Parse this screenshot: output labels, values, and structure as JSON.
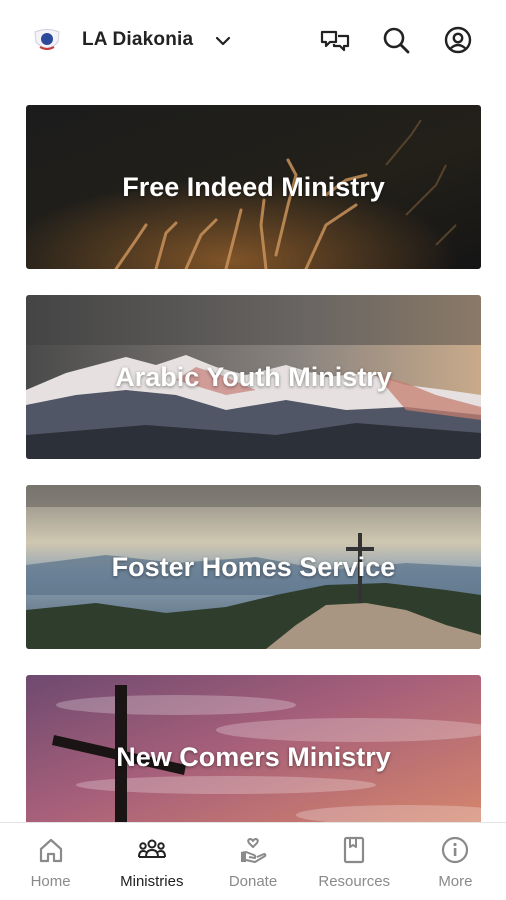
{
  "header": {
    "title": "LA Diakonia",
    "icons": [
      "logo-icon",
      "chevron-down-icon",
      "chat-icon",
      "search-icon",
      "profile-icon"
    ]
  },
  "cards": [
    {
      "title": "Free Indeed Ministry"
    },
    {
      "title": "Arabic Youth Ministry"
    },
    {
      "title": "Foster Homes Service"
    },
    {
      "title": "New Comers Ministry"
    }
  ],
  "nav": {
    "active": "Ministries",
    "items": [
      {
        "label": "Home",
        "icon": "home-icon"
      },
      {
        "label": "Ministries",
        "icon": "people-icon"
      },
      {
        "label": "Donate",
        "icon": "donate-icon"
      },
      {
        "label": "Resources",
        "icon": "book-icon"
      },
      {
        "label": "More",
        "icon": "info-icon"
      }
    ]
  },
  "colors": {
    "text": "#222222",
    "nav_inactive": "#8a8a8a",
    "background": "#ffffff"
  }
}
